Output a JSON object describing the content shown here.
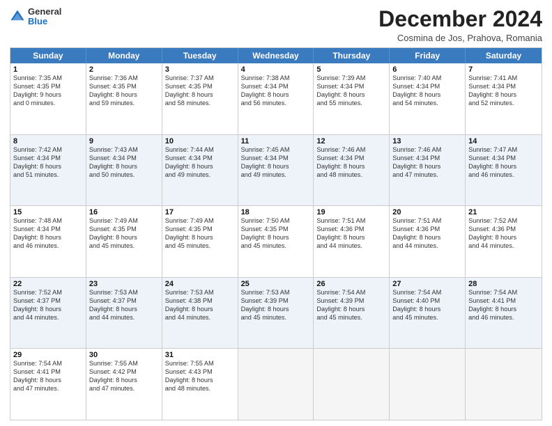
{
  "logo": {
    "general": "General",
    "blue": "Blue"
  },
  "title": "December 2024",
  "subtitle": "Cosmina de Jos, Prahova, Romania",
  "days": [
    "Sunday",
    "Monday",
    "Tuesday",
    "Wednesday",
    "Thursday",
    "Friday",
    "Saturday"
  ],
  "weeks": [
    [
      {
        "day": 1,
        "lines": [
          "Sunrise: 7:35 AM",
          "Sunset: 4:35 PM",
          "Daylight: 9 hours",
          "and 0 minutes."
        ]
      },
      {
        "day": 2,
        "lines": [
          "Sunrise: 7:36 AM",
          "Sunset: 4:35 PM",
          "Daylight: 8 hours",
          "and 59 minutes."
        ]
      },
      {
        "day": 3,
        "lines": [
          "Sunrise: 7:37 AM",
          "Sunset: 4:35 PM",
          "Daylight: 8 hours",
          "and 58 minutes."
        ]
      },
      {
        "day": 4,
        "lines": [
          "Sunrise: 7:38 AM",
          "Sunset: 4:34 PM",
          "Daylight: 8 hours",
          "and 56 minutes."
        ]
      },
      {
        "day": 5,
        "lines": [
          "Sunrise: 7:39 AM",
          "Sunset: 4:34 PM",
          "Daylight: 8 hours",
          "and 55 minutes."
        ]
      },
      {
        "day": 6,
        "lines": [
          "Sunrise: 7:40 AM",
          "Sunset: 4:34 PM",
          "Daylight: 8 hours",
          "and 54 minutes."
        ]
      },
      {
        "day": 7,
        "lines": [
          "Sunrise: 7:41 AM",
          "Sunset: 4:34 PM",
          "Daylight: 8 hours",
          "and 52 minutes."
        ]
      }
    ],
    [
      {
        "day": 8,
        "lines": [
          "Sunrise: 7:42 AM",
          "Sunset: 4:34 PM",
          "Daylight: 8 hours",
          "and 51 minutes."
        ]
      },
      {
        "day": 9,
        "lines": [
          "Sunrise: 7:43 AM",
          "Sunset: 4:34 PM",
          "Daylight: 8 hours",
          "and 50 minutes."
        ]
      },
      {
        "day": 10,
        "lines": [
          "Sunrise: 7:44 AM",
          "Sunset: 4:34 PM",
          "Daylight: 8 hours",
          "and 49 minutes."
        ]
      },
      {
        "day": 11,
        "lines": [
          "Sunrise: 7:45 AM",
          "Sunset: 4:34 PM",
          "Daylight: 8 hours",
          "and 49 minutes."
        ]
      },
      {
        "day": 12,
        "lines": [
          "Sunrise: 7:46 AM",
          "Sunset: 4:34 PM",
          "Daylight: 8 hours",
          "and 48 minutes."
        ]
      },
      {
        "day": 13,
        "lines": [
          "Sunrise: 7:46 AM",
          "Sunset: 4:34 PM",
          "Daylight: 8 hours",
          "and 47 minutes."
        ]
      },
      {
        "day": 14,
        "lines": [
          "Sunrise: 7:47 AM",
          "Sunset: 4:34 PM",
          "Daylight: 8 hours",
          "and 46 minutes."
        ]
      }
    ],
    [
      {
        "day": 15,
        "lines": [
          "Sunrise: 7:48 AM",
          "Sunset: 4:34 PM",
          "Daylight: 8 hours",
          "and 46 minutes."
        ]
      },
      {
        "day": 16,
        "lines": [
          "Sunrise: 7:49 AM",
          "Sunset: 4:35 PM",
          "Daylight: 8 hours",
          "and 45 minutes."
        ]
      },
      {
        "day": 17,
        "lines": [
          "Sunrise: 7:49 AM",
          "Sunset: 4:35 PM",
          "Daylight: 8 hours",
          "and 45 minutes."
        ]
      },
      {
        "day": 18,
        "lines": [
          "Sunrise: 7:50 AM",
          "Sunset: 4:35 PM",
          "Daylight: 8 hours",
          "and 45 minutes."
        ]
      },
      {
        "day": 19,
        "lines": [
          "Sunrise: 7:51 AM",
          "Sunset: 4:36 PM",
          "Daylight: 8 hours",
          "and 44 minutes."
        ]
      },
      {
        "day": 20,
        "lines": [
          "Sunrise: 7:51 AM",
          "Sunset: 4:36 PM",
          "Daylight: 8 hours",
          "and 44 minutes."
        ]
      },
      {
        "day": 21,
        "lines": [
          "Sunrise: 7:52 AM",
          "Sunset: 4:36 PM",
          "Daylight: 8 hours",
          "and 44 minutes."
        ]
      }
    ],
    [
      {
        "day": 22,
        "lines": [
          "Sunrise: 7:52 AM",
          "Sunset: 4:37 PM",
          "Daylight: 8 hours",
          "and 44 minutes."
        ]
      },
      {
        "day": 23,
        "lines": [
          "Sunrise: 7:53 AM",
          "Sunset: 4:37 PM",
          "Daylight: 8 hours",
          "and 44 minutes."
        ]
      },
      {
        "day": 24,
        "lines": [
          "Sunrise: 7:53 AM",
          "Sunset: 4:38 PM",
          "Daylight: 8 hours",
          "and 44 minutes."
        ]
      },
      {
        "day": 25,
        "lines": [
          "Sunrise: 7:53 AM",
          "Sunset: 4:39 PM",
          "Daylight: 8 hours",
          "and 45 minutes."
        ]
      },
      {
        "day": 26,
        "lines": [
          "Sunrise: 7:54 AM",
          "Sunset: 4:39 PM",
          "Daylight: 8 hours",
          "and 45 minutes."
        ]
      },
      {
        "day": 27,
        "lines": [
          "Sunrise: 7:54 AM",
          "Sunset: 4:40 PM",
          "Daylight: 8 hours",
          "and 45 minutes."
        ]
      },
      {
        "day": 28,
        "lines": [
          "Sunrise: 7:54 AM",
          "Sunset: 4:41 PM",
          "Daylight: 8 hours",
          "and 46 minutes."
        ]
      }
    ],
    [
      {
        "day": 29,
        "lines": [
          "Sunrise: 7:54 AM",
          "Sunset: 4:41 PM",
          "Daylight: 8 hours",
          "and 47 minutes."
        ]
      },
      {
        "day": 30,
        "lines": [
          "Sunrise: 7:55 AM",
          "Sunset: 4:42 PM",
          "Daylight: 8 hours",
          "and 47 minutes."
        ]
      },
      {
        "day": 31,
        "lines": [
          "Sunrise: 7:55 AM",
          "Sunset: 4:43 PM",
          "Daylight: 8 hours",
          "and 48 minutes."
        ]
      },
      null,
      null,
      null,
      null
    ]
  ]
}
